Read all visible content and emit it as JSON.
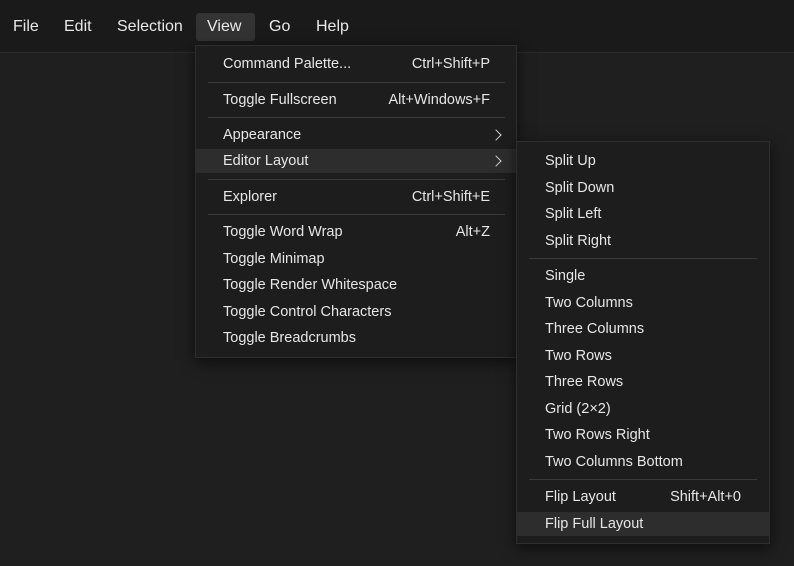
{
  "menubar": {
    "items": [
      "File",
      "Edit",
      "Selection",
      "View",
      "Go",
      "Help"
    ],
    "active": "View"
  },
  "view_menu": {
    "command_palette": {
      "label": "Command Palette...",
      "shortcut": "Ctrl+Shift+P"
    },
    "toggle_fullscreen": {
      "label": "Toggle Fullscreen",
      "shortcut": "Alt+Windows+F"
    },
    "appearance": {
      "label": "Appearance",
      "icon": "chevron-right-icon"
    },
    "editor_layout": {
      "label": "Editor Layout",
      "icon": "chevron-right-icon",
      "highlighted": true
    },
    "explorer": {
      "label": "Explorer",
      "shortcut": "Ctrl+Shift+E"
    },
    "toggle_word_wrap": {
      "label": "Toggle Word Wrap",
      "shortcut": "Alt+Z"
    },
    "toggle_minimap": {
      "label": "Toggle Minimap"
    },
    "toggle_render_whitespace": {
      "label": "Toggle Render Whitespace"
    },
    "toggle_control_characters": {
      "label": "Toggle Control Characters"
    },
    "toggle_breadcrumbs": {
      "label": "Toggle Breadcrumbs"
    }
  },
  "editor_layout_menu": {
    "split_up": "Split Up",
    "split_down": "Split Down",
    "split_left": "Split Left",
    "split_right": "Split Right",
    "single": "Single",
    "two_columns": "Two Columns",
    "three_columns": "Three Columns",
    "two_rows": "Two Rows",
    "three_rows": "Three Rows",
    "grid": "Grid (2×2)",
    "two_rows_right": "Two Rows Right",
    "two_columns_bottom": "Two Columns Bottom",
    "flip_layout": {
      "label": "Flip Layout",
      "shortcut": "Shift+Alt+0"
    },
    "flip_full_layout": {
      "label": "Flip Full Layout",
      "highlighted": true
    }
  },
  "colors": {
    "background": "#1f1f1f",
    "menubar": "#1a1a1a",
    "menu": "#1d1d1d",
    "highlight": "#2d2d2d",
    "active_menubar": "#333333",
    "text": "#e6e6e6",
    "separator": "#3a3a3a"
  }
}
